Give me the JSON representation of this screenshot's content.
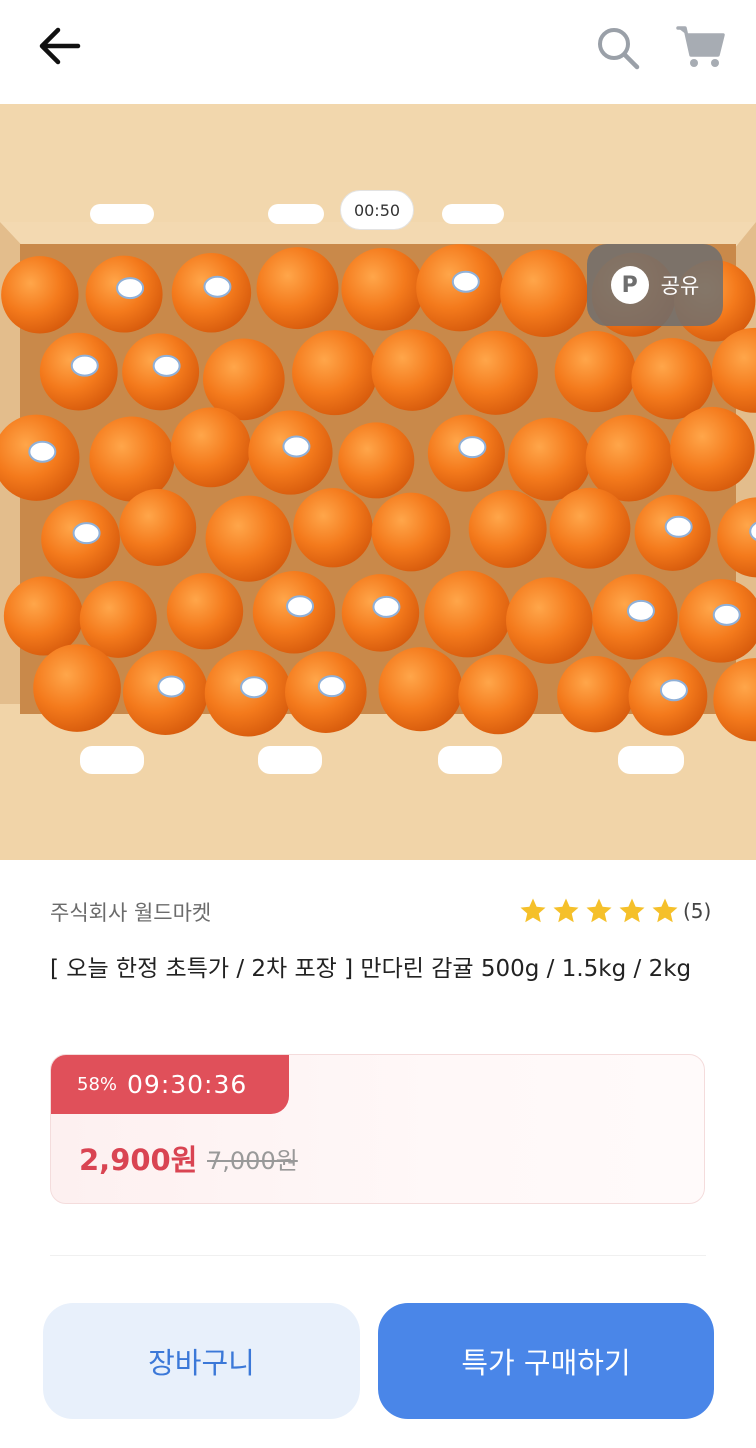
{
  "header": {
    "back_icon": "arrow-left-icon",
    "search_icon": "search-icon",
    "cart_icon": "cart-icon"
  },
  "media": {
    "timer": "00:50",
    "share_label": "공유",
    "share_badge": "P"
  },
  "product": {
    "seller": "주식회사 월드마켓",
    "rating_stars": 5,
    "review_count": "(5)",
    "title": "[ 오늘 한정 초특가 / 2차 포장 ] 만다린 감귤 500g / 1.5kg / 2kg"
  },
  "deal": {
    "discount": "58%",
    "countdown": "09:30:36",
    "price": "2,900원",
    "original_price": "7,000원",
    "accent_color": "#e0505a"
  },
  "actions": {
    "cart_label": "장바구니",
    "buy_label": "특가 구매하기",
    "primary_color": "#4a86e8"
  }
}
